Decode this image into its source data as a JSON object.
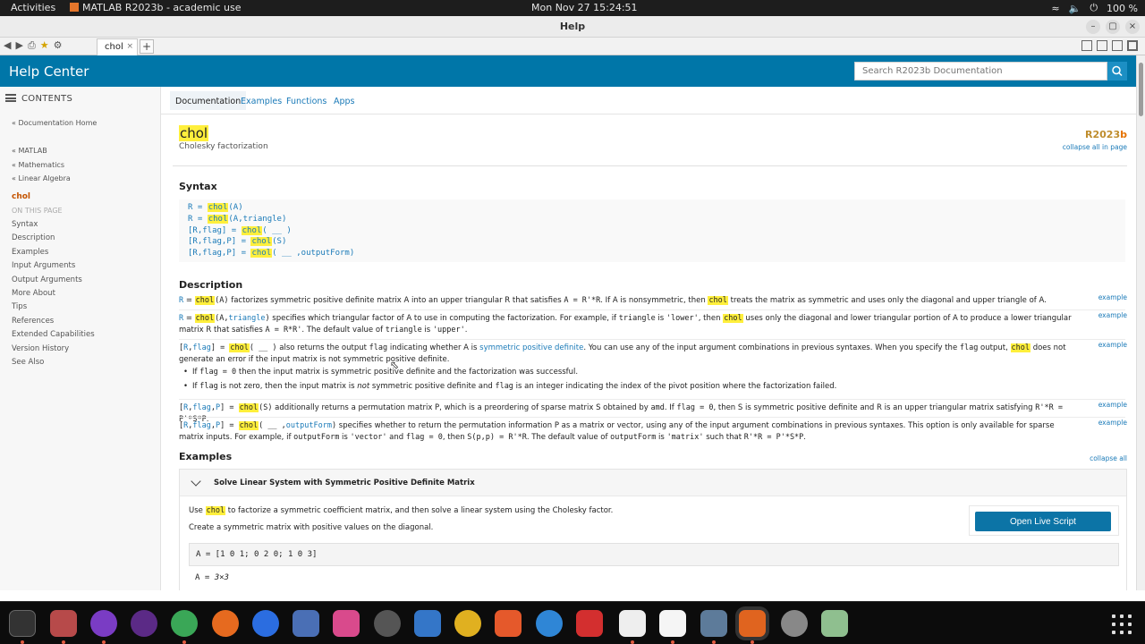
{
  "system": {
    "activities": "Activities",
    "app_name": "MATLAB R2023b - academic use",
    "clock": "Mon Nov 27  15:24:51",
    "battery": "100 %"
  },
  "window": {
    "title": "Help"
  },
  "browser": {
    "tab_label": "chol",
    "tab_close": "×",
    "new_tab": "+"
  },
  "header": {
    "title": "Help Center",
    "search_placeholder": "Search R2023b Documentation"
  },
  "sidebar": {
    "contents_label": "CONTENTS",
    "breadcrumbs": [
      "« Documentation Home",
      "",
      "« MATLAB",
      "« Mathematics",
      "« Linear Algebra"
    ],
    "current": "chol",
    "on_this_page": "ON THIS PAGE",
    "toc": [
      "Syntax",
      "Description",
      "Examples",
      "Input Arguments",
      "Output Arguments",
      "More About",
      "Tips",
      "References",
      "Extended Capabilities",
      "Version History",
      "See Also"
    ]
  },
  "doc_tabs": [
    "Documentation",
    "Examples",
    "Functions",
    "Apps"
  ],
  "page": {
    "title": "chol",
    "subtitle": "Cholesky factorization",
    "release_prefix": "R2023",
    "release_suffix": "b",
    "collapse_all_in_page": "collapse all in page",
    "syntax_heading": "Syntax",
    "syntax_lines": [
      [
        "R = ",
        "chol",
        "(A)"
      ],
      [
        "R = ",
        "chol",
        "(A,triangle)"
      ],
      [
        "[R,flag] = ",
        "chol",
        "( __ )"
      ],
      [
        "[R,flag,P] = ",
        "chol",
        "(S)"
      ],
      [
        "[R,flag,P] = ",
        "chol",
        "( __ ,outputForm)"
      ]
    ],
    "description_heading": "Description",
    "example_link": "example",
    "examples_heading": "Examples",
    "collapse_all": "collapse all",
    "example": {
      "title": "Solve Linear System with Symmetric Positive Definite Matrix",
      "p1_pre": "Use ",
      "p1_kw": "chol",
      "p1_post": " to factorize a symmetric coefficient matrix, and then solve a linear system using the Cholesky factor.",
      "p2": "Create a symmetric matrix with positive values on the diagonal.",
      "live_button": "Open Live Script",
      "code": "A = [1 0 1; 0 2 0; 1 0 3]",
      "output_prefix": "A = ",
      "output_size": "3×3"
    }
  }
}
